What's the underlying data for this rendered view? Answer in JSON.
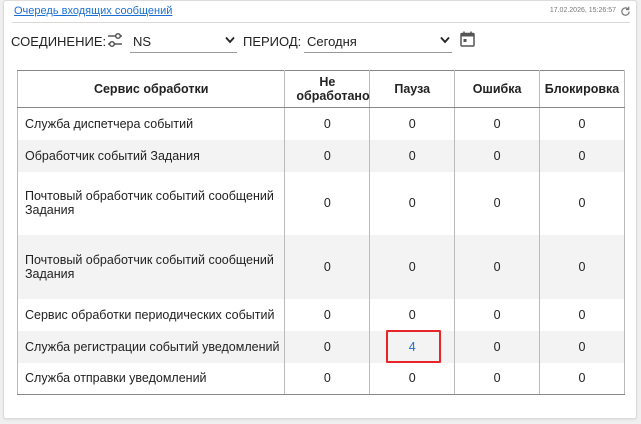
{
  "widget": {
    "title": "Очередь входящих сообщений",
    "timestamp": "17.02.2026, 15:26:57"
  },
  "filters": {
    "connection_label": "СОЕДИНЕНИЕ:",
    "connection_value": "NS",
    "period_label": "ПЕРИОД:",
    "period_value": "Сегодня"
  },
  "table": {
    "headers": [
      "Сервис обработки",
      "Не обработано",
      "Пауза",
      "Ошибка",
      "Блокировка"
    ],
    "rows": [
      {
        "service": "Служба диспетчера событий",
        "unprocessed": "0",
        "pause": "0",
        "error": "0",
        "lock": "0"
      },
      {
        "service": "Обработчик событий Задания",
        "unprocessed": "0",
        "pause": "0",
        "error": "0",
        "lock": "0"
      },
      {
        "service": "Почтовый обработчик событий сообщений Задания",
        "unprocessed": "0",
        "pause": "0",
        "error": "0",
        "lock": "0"
      },
      {
        "service": "Почтовый обработчик событий сообщений Задания",
        "unprocessed": "0",
        "pause": "0",
        "error": "0",
        "lock": "0"
      },
      {
        "service": "Сервис обработки периодических событий",
        "unprocessed": "0",
        "pause": "0",
        "error": "0",
        "lock": "0"
      },
      {
        "service": "Служба регистрации событий уведомлений",
        "unprocessed": "0",
        "pause": "4",
        "error": "0",
        "lock": "0"
      },
      {
        "service": "Служба отправки уведомлений",
        "unprocessed": "0",
        "pause": "0",
        "error": "0",
        "lock": "0"
      }
    ]
  },
  "colors": {
    "link": "#1a6fd1",
    "highlight": "#e8262a"
  }
}
